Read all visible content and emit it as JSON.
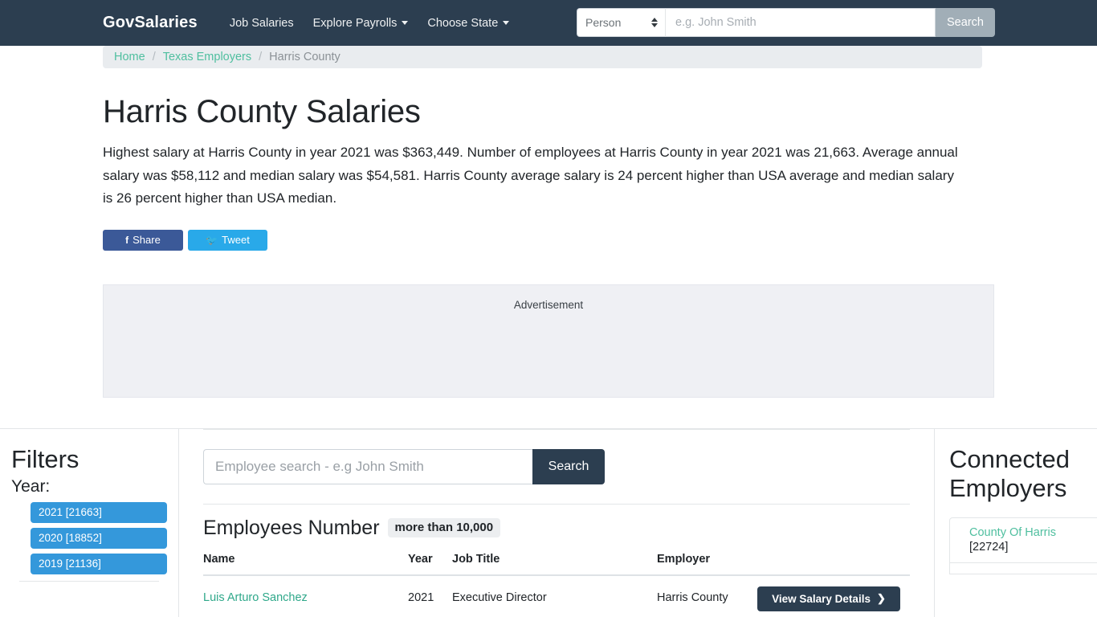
{
  "navbar": {
    "brand": "GovSalaries",
    "links": [
      {
        "label": "Job Salaries",
        "has_caret": false
      },
      {
        "label": "Explore Payrolls",
        "has_caret": true
      },
      {
        "label": "Choose State",
        "has_caret": true
      }
    ],
    "search": {
      "select_value": "Person",
      "input_value": "",
      "input_placeholder": "e.g. John Smith",
      "button_label": "Search"
    }
  },
  "breadcrumb": {
    "items": [
      {
        "label": "Home",
        "active": false
      },
      {
        "label": "Texas Employers",
        "active": false
      },
      {
        "label": "Harris County",
        "active": true
      }
    ],
    "separator": "/"
  },
  "hero": {
    "title": "Harris County Salaries",
    "description": "Highest salary at Harris County in year 2021 was $363,449. Number of employees at Harris County in year 2021 was 21,663. Average annual salary was $58,112 and median salary was $54,581. Harris County average salary is 24 percent higher than USA average and median salary is 26 percent higher than USA median.",
    "share_label": "Share",
    "tweet_label": "Tweet",
    "facebook_glyph": "f",
    "twitter_glyph": "🐦"
  },
  "advertisement": {
    "label": "Advertisement"
  },
  "filters": {
    "title": "Filters",
    "year_label": "Year:",
    "years": [
      {
        "label": "2021 [21663]"
      },
      {
        "label": "2020 [18852]"
      },
      {
        "label": "2019 [21136]"
      }
    ]
  },
  "employee_search": {
    "placeholder": "Employee search - e.g John Smith",
    "value": "",
    "button_label": "Search"
  },
  "employees": {
    "heading": "Employees Number",
    "badge": "more than 10,000",
    "columns": [
      "Name",
      "Year",
      "Job Title",
      "Employer",
      ""
    ],
    "rows": [
      {
        "name": "Luis Arturo Sanchez",
        "year": "2021",
        "job_title": "Executive Director",
        "employer": "Harris County",
        "action_label": "View Salary Details",
        "action_chevron": "❯"
      }
    ]
  },
  "connected_employers": {
    "title": "Connected Employers",
    "items": [
      {
        "name": "County Of Harris",
        "count": "[22724]"
      }
    ]
  },
  "colors": {
    "navbar_bg": "#2c3e50",
    "breadcrumb_bg": "#e9ecef",
    "link_teal": "#4fbf9f",
    "filter_blue": "#3498db",
    "facebook_blue": "#3b5998",
    "twitter_blue": "#29a9e9",
    "ad_bg": "#eff0f4"
  }
}
